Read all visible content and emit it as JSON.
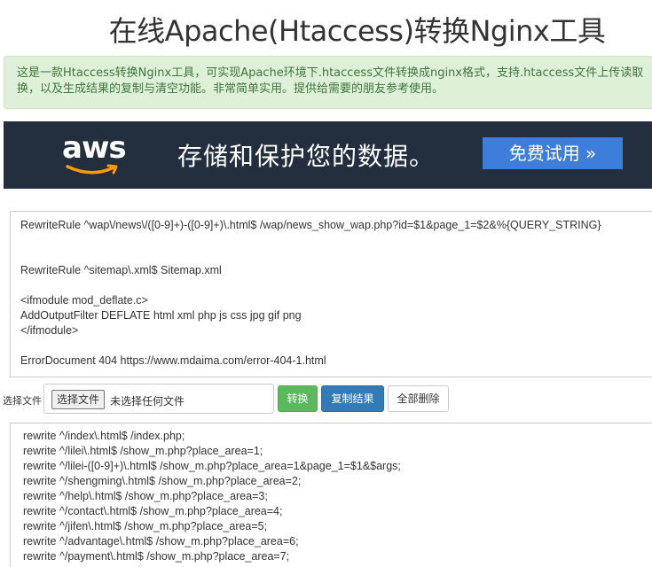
{
  "header": {
    "title": "在线Apache(Htaccess)转换Nginx工具"
  },
  "intro": {
    "line1": "这是一款Htaccess转换Nginx工具，可实现Apache环境下.htaccess文件转换成nginx格式，支持.htaccess文件上传读取",
    "line2": "换，以及生成结果的复制与清空功能。非常简单实用。提供给需要的朋友参考使用。"
  },
  "banner": {
    "logo_text": "aws",
    "headline": "存储和保护您的数据。",
    "cta_label": "免费试用 »"
  },
  "source": {
    "lines": [
      "RewriteRule ^wap\\/news\\/([0-9]+)-([0-9]+)\\.html$ /wap/news_show_wap.php?id=$1&page_1=$2&%{QUERY_STRING}",
      "",
      "",
      "RewriteRule ^sitemap\\.xml$ Sitemap.xml",
      "",
      "<ifmodule mod_deflate.c>",
      "AddOutputFilter DEFLATE html xml php js css jpg gif png",
      "</ifmodule>",
      "",
      "ErrorDocument 404 https://www.mdaima.com/error-404-1.html"
    ]
  },
  "controls": {
    "file_label": "选择文件",
    "file_button": "选择文件",
    "file_status": "未选择任何文件",
    "convert_label": "转换",
    "copy_label": "复制结果",
    "clear_label": "全部删除"
  },
  "result": {
    "lines": [
      "rewrite ^/index\\.html$ /index.php;",
      "rewrite ^/lilei\\.html$ /show_m.php?place_area=1;",
      "rewrite ^/lilei-([0-9]+)\\.html$ /show_m.php?place_area=1&page_1=$1&$args;",
      "rewrite ^/shengming\\.html$ /show_m.php?place_area=2;",
      "rewrite ^/help\\.html$ /show_m.php?place_area=3;",
      "rewrite ^/contact\\.html$ /show_m.php?place_area=4;",
      "rewrite ^/jifen\\.html$ /show_m.php?place_area=5;",
      "rewrite ^/advantage\\.html$ /show_m.php?place_area=6;",
      "rewrite ^/payment\\.html$ /show_m.php?place_area=7;"
    ]
  },
  "colors": {
    "banner_bg": "#232f3e",
    "cta_bg": "#3f7ddb",
    "intro_bg": "#dff0d8",
    "convert_bg": "#5cb85c",
    "copy_bg": "#337ab7"
  }
}
